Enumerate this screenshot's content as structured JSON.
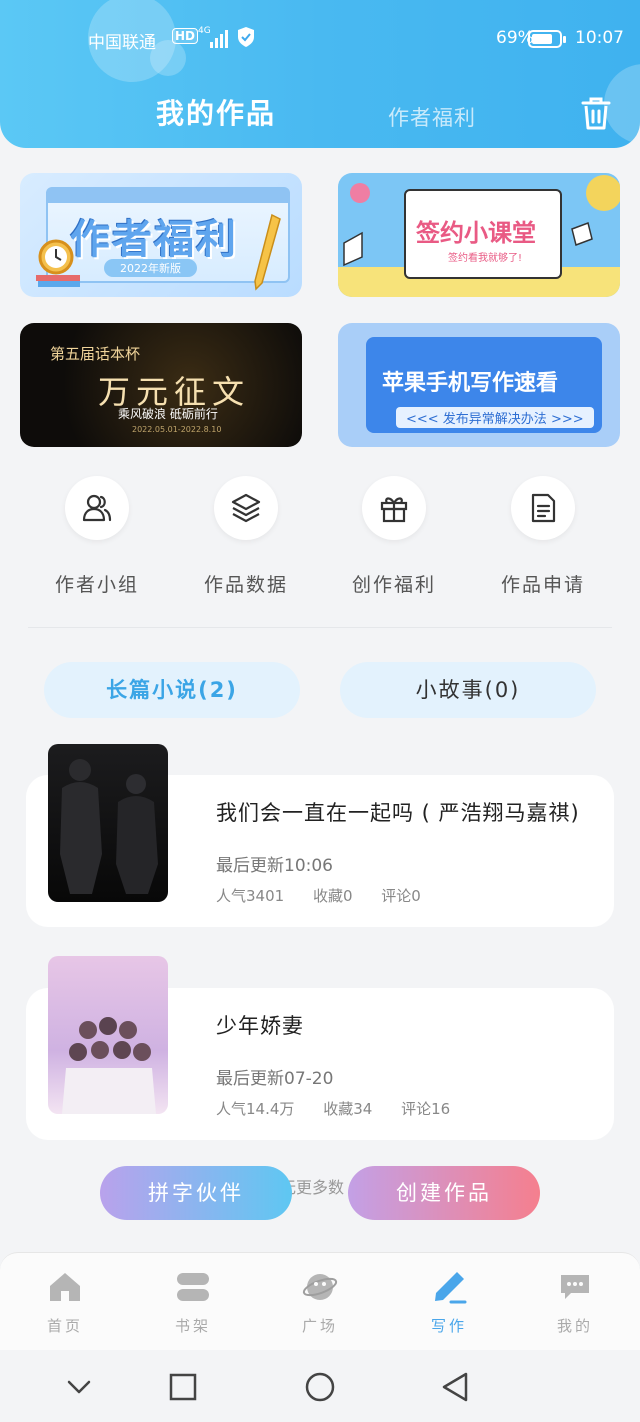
{
  "status_bar": {
    "carrier": "中国联通",
    "hd": "HD",
    "network": "4G",
    "battery": "69%",
    "time": "10:07"
  },
  "header": {
    "tab_active": "我的作品",
    "tab_inactive": "作者福利",
    "trash_icon": "trash-icon"
  },
  "banners": [
    {
      "title": "作者福利",
      "subtitle": "2022年新版"
    },
    {
      "title": "签约小课堂",
      "subtitle": "签约看我就够了!"
    },
    {
      "top": "第五届话本杯",
      "title": "万元征文",
      "subtitle": "乘风破浪 砥砺前行",
      "date": "2022.05.01-2022.8.10"
    },
    {
      "title": "苹果手机写作速看",
      "subtitle": "<<< 发布异常解决办法 >>>"
    }
  ],
  "quick_actions": [
    {
      "label": "作者小组",
      "icon": "users-icon"
    },
    {
      "label": "作品数据",
      "icon": "layers-icon"
    },
    {
      "label": "创作福利",
      "icon": "gift-icon"
    },
    {
      "label": "作品申请",
      "icon": "document-icon"
    }
  ],
  "segments": {
    "long": "长篇小说(2)",
    "short": "小故事(0)"
  },
  "works": [
    {
      "title": "我们会一直在一起吗 ( 严浩翔马嘉祺)",
      "updated": "最后更新10:06",
      "popularity": "人气3401",
      "favorites": "收藏0",
      "comments": "评论0"
    },
    {
      "title": "少年娇妻",
      "updated": "最后更新07-20",
      "popularity": "人气14.4万",
      "favorites": "收藏34",
      "comments": "评论16"
    }
  ],
  "more_text": "无更多数",
  "buttons": {
    "partner": "拼字伙伴",
    "create": "创建作品"
  },
  "bottom_nav": [
    {
      "label": "首页",
      "icon": "home-icon"
    },
    {
      "label": "书架",
      "icon": "bookshelf-icon"
    },
    {
      "label": "广场",
      "icon": "planet-icon"
    },
    {
      "label": "写作",
      "icon": "pen-icon",
      "active": true
    },
    {
      "label": "我的",
      "icon": "chat-icon"
    }
  ],
  "colors": {
    "accent": "#4aa6ea",
    "header": "#49b9f1"
  }
}
